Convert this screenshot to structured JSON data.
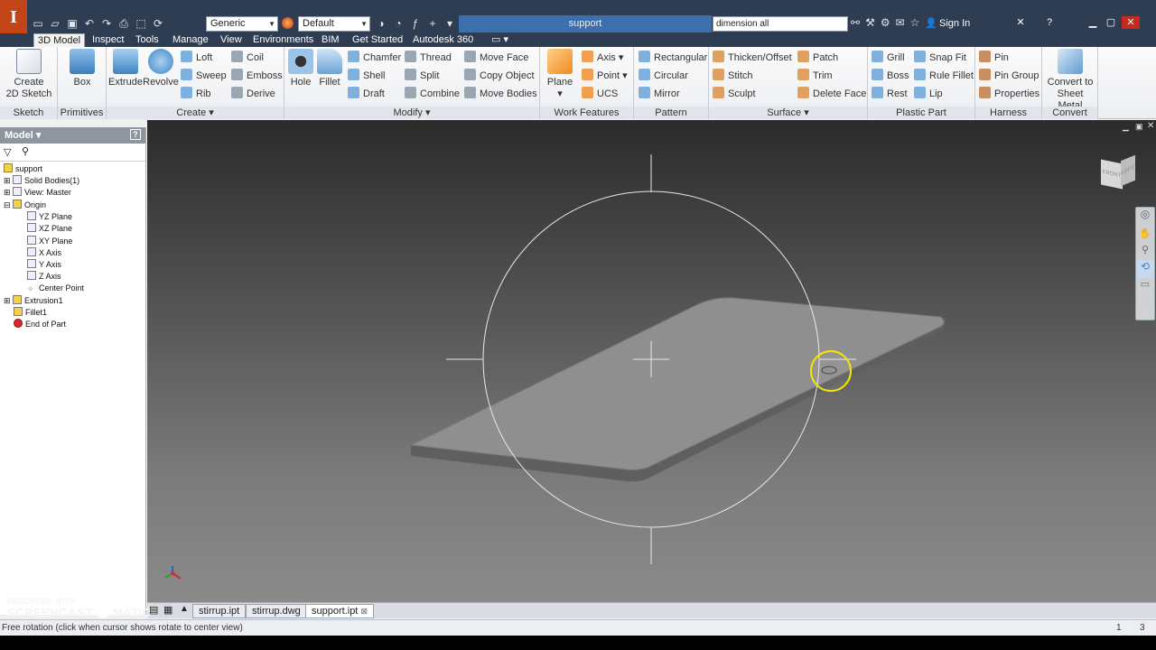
{
  "title_bar": {
    "app_logo": "I",
    "material_combo": "Generic",
    "appearance_combo": "Default",
    "document_title": "support",
    "help_search": "dimension all",
    "signin": "Sign In"
  },
  "tabs": [
    {
      "label": "3D Model"
    },
    {
      "label": "Inspect"
    },
    {
      "label": "Tools"
    },
    {
      "label": "Manage"
    },
    {
      "label": "View"
    },
    {
      "label": "Environments"
    },
    {
      "label": "BIM"
    },
    {
      "label": "Get Started"
    },
    {
      "label": "Autodesk 360"
    }
  ],
  "ribbon": {
    "sketch": {
      "create_l1": "Create",
      "create_l2": "2D Sketch",
      "label": "Sketch"
    },
    "primitives": {
      "box": "Box",
      "label": "Primitives"
    },
    "create": {
      "extrude": "Extrude",
      "revolve": "Revolve",
      "loft": "Loft",
      "sweep": "Sweep",
      "rib": "Rib",
      "coil": "Coil",
      "emboss": "Emboss",
      "derive": "Derive",
      "label": "Create"
    },
    "modify": {
      "hole": "Hole",
      "fillet": "Fillet",
      "chamfer": "Chamfer",
      "shell": "Shell",
      "draft": "Draft",
      "thread": "Thread",
      "split": "Split",
      "combine": "Combine",
      "move_face": "Move Face",
      "copy_object": "Copy Object",
      "move_bodies": "Move Bodies",
      "label": "Modify"
    },
    "work_features": {
      "plane": "Plane",
      "axis": "Axis",
      "point": "Point",
      "ucs": "UCS",
      "label": "Work Features"
    },
    "pattern": {
      "rectangular": "Rectangular",
      "circular": "Circular",
      "mirror": "Mirror",
      "label": "Pattern"
    },
    "surface": {
      "thicken_offset": "Thicken/Offset",
      "stitch": "Stitch",
      "sculpt": "Sculpt",
      "patch": "Patch",
      "trim": "Trim",
      "delete_face": "Delete Face",
      "label": "Surface"
    },
    "plastic_part": {
      "grill": "Grill",
      "boss": "Boss",
      "rest": "Rest",
      "snap_fit": "Snap Fit",
      "rule_fillet": "Rule Fillet",
      "lip": "Lip",
      "label": "Plastic Part"
    },
    "harness": {
      "pin": "Pin",
      "pin_group": "Pin Group",
      "properties": "Properties",
      "label": "Harness"
    },
    "convert": {
      "l1": "Convert to",
      "l2": "Sheet Metal",
      "label": "Convert"
    }
  },
  "browser": {
    "title": "Model",
    "items": [
      {
        "label": "support"
      },
      {
        "label": "Solid Bodies(1)"
      },
      {
        "label": "View: Master"
      },
      {
        "label": "Origin"
      },
      {
        "label": "YZ Plane"
      },
      {
        "label": "XZ Plane"
      },
      {
        "label": "XY Plane"
      },
      {
        "label": "X Axis"
      },
      {
        "label": "Y Axis"
      },
      {
        "label": "Z Axis"
      },
      {
        "label": "Center Point"
      },
      {
        "label": "Extrusion1"
      },
      {
        "label": "Fillet1"
      },
      {
        "label": "End of Part"
      }
    ]
  },
  "viewcube_faces": {
    "front": "FRONT",
    "left": "LEFT"
  },
  "doc_tabs": [
    {
      "label": "stirrup.ipt"
    },
    {
      "label": "stirrup.dwg"
    },
    {
      "label": "support.ipt"
    }
  ],
  "status": {
    "message": "Free rotation (click when cursor shows rotate to center view)",
    "count_a": "1",
    "count_b": "3"
  },
  "watermark": {
    "line1": "RECORDED WITH",
    "line2": "SCREENCAST",
    "line3": "MATIC"
  },
  "colors": {
    "accent": "#3c6fae",
    "titlebar": "#2e3d52",
    "logo": "#c2451a",
    "cursor_highlight": "#f5e600"
  }
}
